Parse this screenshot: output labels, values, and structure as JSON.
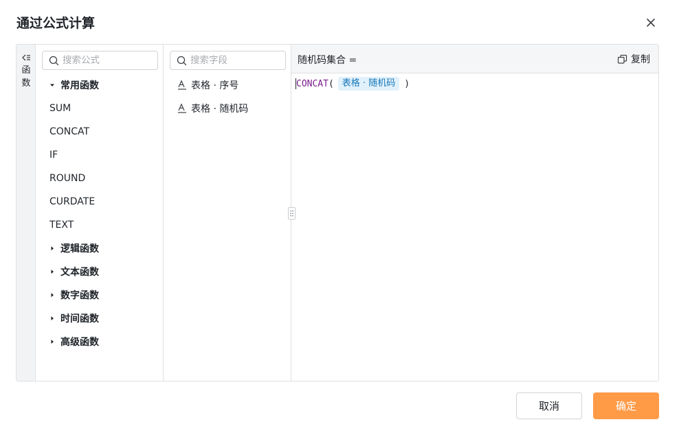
{
  "dialog": {
    "title": "通过公式计算"
  },
  "sidebar": {
    "collapse_label": "函数"
  },
  "functions": {
    "search_placeholder": "搜索公式",
    "common_group": "常用函数",
    "common_items": [
      "SUM",
      "CONCAT",
      "IF",
      "ROUND",
      "CURDATE",
      "TEXT"
    ],
    "groups": [
      "逻辑函数",
      "文本函数",
      "数字函数",
      "时间函数",
      "高级函数"
    ]
  },
  "fields": {
    "search_placeholder": "搜索字段",
    "items": [
      "表格 · 序号",
      "表格 · 随机码"
    ]
  },
  "editor": {
    "result_label": "随机码集合 =",
    "copy_label": "复制",
    "formula_function": "CONCAT",
    "open_paren": "(",
    "field_token": "表格 · 随机码",
    "close_paren": ")"
  },
  "footer": {
    "cancel_label": "取消",
    "ok_label": "确定"
  },
  "colors": {
    "accent": "#ff9a47",
    "function_name": "#7a1e8c",
    "field_token_bg": "#e1f1fb",
    "field_token_text": "#1677b8"
  }
}
